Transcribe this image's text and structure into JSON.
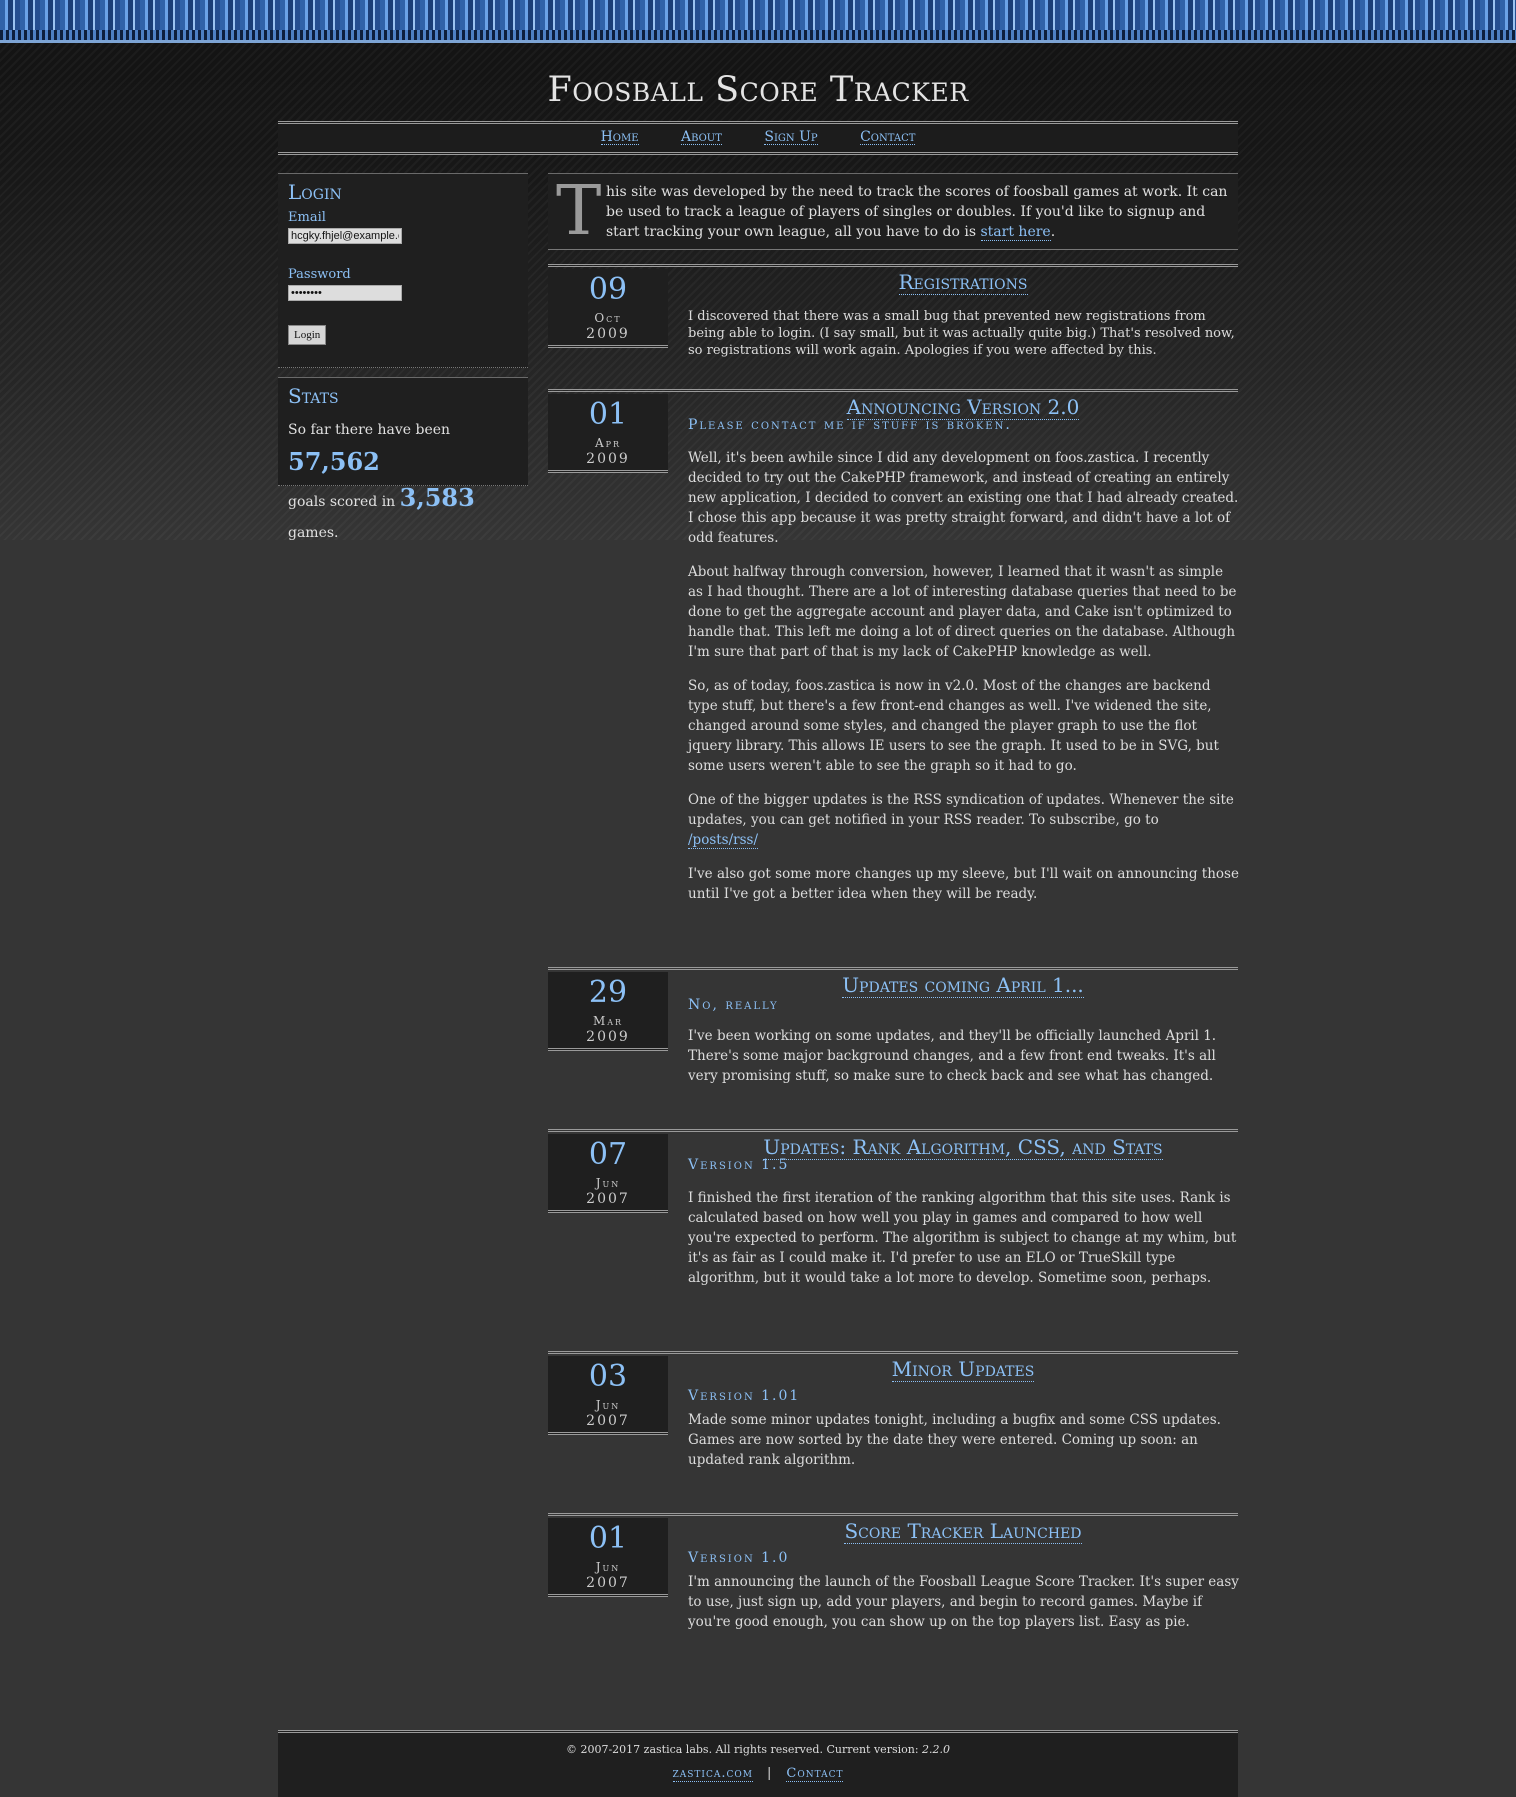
{
  "site": {
    "title": "Foosball Score Tracker"
  },
  "nav": {
    "items": [
      "Home",
      "About",
      "Sign Up",
      "Contact"
    ]
  },
  "login": {
    "heading": "Login",
    "email_label": "Email",
    "email_value": "hcgky.fhjel@example.c",
    "password_label": "Password",
    "password_value": "••••••••",
    "button_label": "Login"
  },
  "stats": {
    "heading": "Stats",
    "text1": "So far there have been ",
    "goals": "57,562",
    "text2": "goals scored in ",
    "games": "3,583",
    "text3": " games."
  },
  "intro": {
    "dropcap": "T",
    "text": "his site was developed by the need to track the scores of foosball games at work. It can be used to track a league of players of singles or doubles. If you'd like to signup and start tracking your own league, all you have to do is ",
    "link": "start here",
    "end": "."
  },
  "posts": [
    {
      "day": "09",
      "month": "Oct",
      "year": "2009",
      "title": "Registrations",
      "subtitle": "",
      "paragraphs": [
        "I discovered that there was a small bug that prevented new registrations from being able to login. (I say small, but it was actually quite big.) That's resolved now, so registrations will work again. Apologies if you were affected by this."
      ]
    },
    {
      "day": "01",
      "month": "Apr",
      "year": "2009",
      "title": "Announcing Version 2.0",
      "subtitle": "Please contact me if stuff is broken.",
      "paragraphs": [
        "Well, it's been awhile since I did any development on foos.zastica. I recently decided to try out the CakePHP framework, and instead of creating an entirely new application, I decided to convert an existing one that I had already created. I chose this app because it was pretty straight forward, and didn't have a lot of odd features.",
        "About halfway through conversion, however, I learned that it wasn't as simple as I had thought. There are a lot of interesting database queries that need to be done to get the aggregate account and player data, and Cake isn't optimized to handle that. This left me doing a lot of direct queries on the database. Although I'm sure that part of that is my lack of CakePHP knowledge as well.",
        "So, as of today, foos.zastica is now in v2.0. Most of the changes are backend type stuff, but there's a few front-end changes as well. I've widened the site, changed around some styles, and changed the player graph to use the flot jquery library. This allows IE users to see the graph. It used to be in SVG, but some users weren't able to see the graph so it had to go.",
        "One of the bigger updates is the RSS syndication of updates. Whenever the site updates, you can get notified in your RSS reader. To subscribe, go to",
        "I've also got some more changes up my sleeve, but I'll wait on announcing those until I've got a better idea when they will be ready."
      ],
      "rss_link": "/posts/rss/"
    },
    {
      "day": "29",
      "month": "Mar",
      "year": "2009",
      "title": "Updates coming April 1...",
      "subtitle": "No, really",
      "paragraphs": [
        "I've been working on some updates, and they'll be officially launched April 1. There's some major background changes, and a few front end tweaks. It's all very promising stuff, so make sure to check back and see what has changed."
      ]
    },
    {
      "day": "07",
      "month": "Jun",
      "year": "2007",
      "title": "Updates: Rank Algorithm, CSS, and Stats",
      "subtitle": "Version 1.5",
      "paragraphs": [
        "I finished the first iteration of the ranking algorithm that this site uses. Rank is calculated based on how well you play in games and compared to how well you're expected to perform. The algorithm is subject to change at my whim, but it's as fair as I could make it. I'd prefer to use an ELO or TrueSkill type algorithm, but it would take a lot more to develop. Sometime soon, perhaps."
      ]
    },
    {
      "day": "03",
      "month": "Jun",
      "year": "2007",
      "title": "Minor Updates",
      "subtitle": "Version 1.01",
      "paragraphs": [
        "Made some minor updates tonight, including a bugfix and some CSS updates. Games are now sorted by the date they were entered. Coming up soon: an updated rank algorithm."
      ]
    },
    {
      "day": "01",
      "month": "Jun",
      "year": "2007",
      "title": "Score Tracker Launched",
      "subtitle": "Version 1.0",
      "paragraphs": [
        "I'm announcing the launch of the Foosball League Score Tracker. It's super easy to use, just sign up, add your players, and begin to record games. Maybe if you're good enough, you can show up on the top players list. Easy as pie."
      ]
    }
  ],
  "footer": {
    "copyright": "© 2007-2017 zastica labs. All rights reserved. Current version: ",
    "version": "2.2.0",
    "link1": "zastica.com",
    "separator": "|",
    "link2": "Contact"
  },
  "colors": {
    "accent": "#8cc0f5",
    "panel": "#1f1f1f",
    "background": "#353535"
  }
}
